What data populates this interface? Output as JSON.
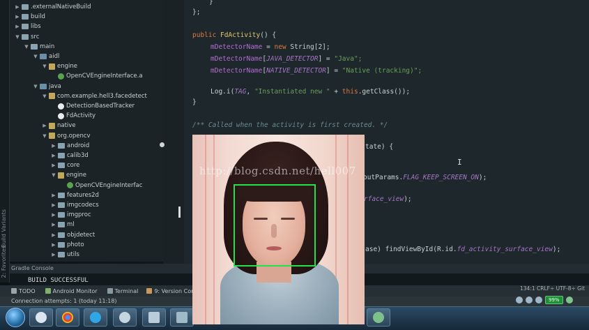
{
  "project_tree": [
    {
      "label": ".externalNativeBuild",
      "indent": 0,
      "icon": "folder"
    },
    {
      "label": "build",
      "indent": 0,
      "icon": "folder"
    },
    {
      "label": "libs",
      "indent": 0,
      "icon": "folder"
    },
    {
      "label": "src",
      "indent": 0,
      "icon": "folder"
    },
    {
      "label": "main",
      "indent": 1,
      "icon": "folder"
    },
    {
      "label": "aidl",
      "indent": 2,
      "icon": "folder-src"
    },
    {
      "label": "engine",
      "indent": 3,
      "icon": "package"
    },
    {
      "label": "OpenCVEngineInterface.a",
      "indent": 4,
      "icon": "class"
    },
    {
      "label": "java",
      "indent": 2,
      "icon": "folder-src"
    },
    {
      "label": "com.example.hell3.facedetect",
      "indent": 3,
      "icon": "package"
    },
    {
      "label": "DetectionBasedTracker",
      "indent": 4,
      "icon": "circle"
    },
    {
      "label": "FdActivity",
      "indent": 4,
      "icon": "circle"
    },
    {
      "label": "native",
      "indent": 3,
      "icon": "package"
    },
    {
      "label": "org.opencv",
      "indent": 3,
      "icon": "package"
    },
    {
      "label": "android",
      "indent": 4,
      "icon": "folder"
    },
    {
      "label": "calib3d",
      "indent": 4,
      "icon": "folder"
    },
    {
      "label": "core",
      "indent": 4,
      "icon": "folder"
    },
    {
      "label": "engine",
      "indent": 4,
      "icon": "package"
    },
    {
      "label": "OpenCVEngineInterfac",
      "indent": 5,
      "icon": "class"
    },
    {
      "label": "features2d",
      "indent": 4,
      "icon": "folder"
    },
    {
      "label": "imgcodecs",
      "indent": 4,
      "icon": "folder"
    },
    {
      "label": "imgproc",
      "indent": 4,
      "icon": "folder"
    },
    {
      "label": "ml",
      "indent": 4,
      "icon": "folder"
    },
    {
      "label": "objdetect",
      "indent": 4,
      "icon": "folder"
    },
    {
      "label": "photo",
      "indent": 4,
      "icon": "folder"
    },
    {
      "label": "utils",
      "indent": 4,
      "icon": "folder"
    }
  ],
  "left_strip": {
    "favorites": "2: Favorites",
    "build_variants": "Build Variants"
  },
  "code": {
    "l0": "}",
    "l1": "};",
    "l2a": "public ",
    "l2b": "FdActivity",
    "l2c": "() {",
    "l3a": "mDetectorName",
    "l3b": " = ",
    "l3c": "new ",
    "l3d": "String[2];",
    "l4a": "mDetectorName",
    "l4b": "[",
    "l4c": "JAVA_DETECTOR",
    "l4d": "] = ",
    "l4e": "\"Java\";",
    "l5a": "mDetectorName",
    "l5b": "[",
    "l5c": "NATIVE_DETECTOR",
    "l5d": "] = ",
    "l5e": "\"Native (tracking)\";",
    "l6a": "Log.i(",
    "l6b": "TAG",
    "l6c": ", ",
    "l6d": "\"Instantiated new \"",
    "l6e": " + ",
    "l6f": "this",
    "l6g": ".getClass());",
    "l7": "}",
    "l8": "/** Called when the activity is first created. */",
    "l9": "tate) {",
    "l10a": "outParams.",
    "l10b": "FLAG_KEEP_SCREEN_ON",
    "l10c": ");",
    "l11a": "rface_view",
    "l11b": ");",
    "l12a": "ase) findViewById(R.id.",
    "l12b": "fd_activity_surface_view",
    "l12c": ");"
  },
  "bottom": {
    "gradle_console_title": "Gradle Console",
    "build_message": "BUILD SUCCESSFUL",
    "toolwindows": [
      {
        "label": "TODO",
        "color": "#9aa5aa"
      },
      {
        "label": "Android Monitor",
        "color": "#7fb36d"
      },
      {
        "label": "Terminal",
        "color": "#8a9aa3"
      },
      {
        "label": "9: Version Cont",
        "color": "#c59a5a"
      }
    ],
    "status_text": "Connection attempts: 1 (today 11:18)",
    "status_right": "134:1  CRLF÷  UTF-8÷  Git"
  },
  "tray": {
    "battery": "99%"
  },
  "overlay": {
    "watermark": "http://blog.csdn.net/hell007"
  },
  "colors": {
    "detection_box": "#24e04a",
    "keyword": "#d87a3f",
    "string": "#6aa05a",
    "field": "#b56cd3"
  }
}
